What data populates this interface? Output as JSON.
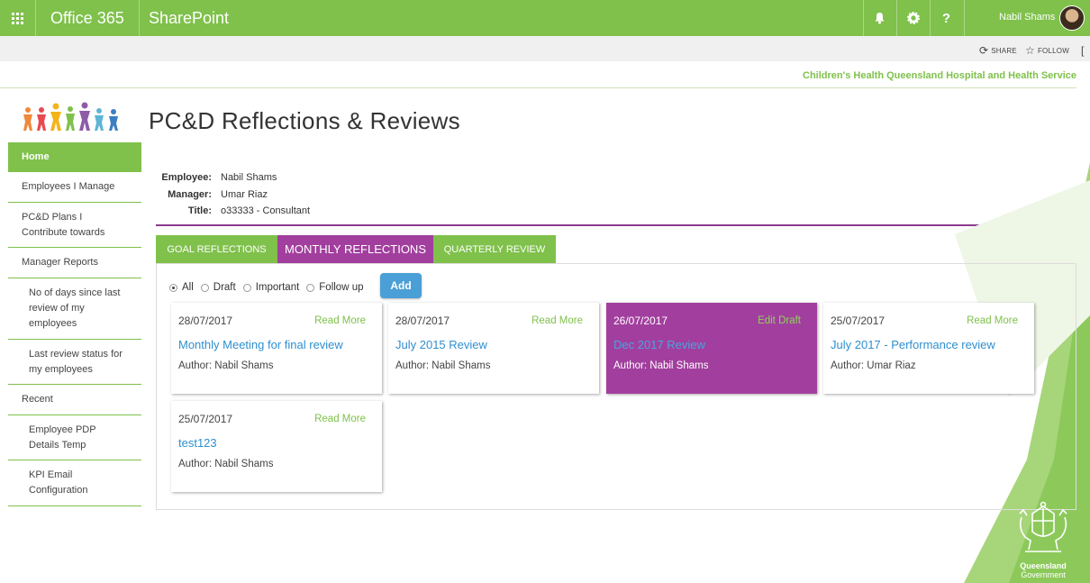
{
  "suitebar": {
    "brand": "Office 365",
    "app": "SharePoint",
    "help": "?",
    "user_name": "Nabil Shams"
  },
  "actions": {
    "share": "SHARE",
    "follow": "FOLLOW"
  },
  "org_name": "Children's Health Queensland Hospital and Health Service",
  "page_title": "PC&D Reflections & Reviews",
  "nav": [
    {
      "label": "Home",
      "active": true
    },
    {
      "label": "Employees I Manage"
    },
    {
      "label": "PC&D Plans I Contribute towards"
    },
    {
      "label": "Manager Reports"
    },
    {
      "label": "No of days since last review of my employees"
    },
    {
      "label": "Last review status for my employees"
    },
    {
      "label": "Recent"
    },
    {
      "label": "Employee PDP Details Temp"
    },
    {
      "label": "KPI Email Configuration"
    }
  ],
  "employee": {
    "employee_label": "Employee:",
    "employee": "Nabil Shams",
    "manager_label": "Manager:",
    "manager": "Umar Riaz",
    "title_label": "Title:",
    "title": "o33333 - Consultant"
  },
  "tabs": [
    "GOAL REFLECTIONS",
    "MONTHLY REFLECTIONS",
    "QUARTERLY REVIEW"
  ],
  "active_tab": "MONTHLY REFLECTIONS",
  "filters": {
    "options": [
      "All",
      "Draft",
      "Important",
      "Follow up"
    ],
    "selected": "All",
    "add_label": "Add"
  },
  "cards": [
    {
      "date": "28/07/2017",
      "link": "Read More",
      "title": "Monthly Meeting for final review",
      "author": "Author: Nabil Shams"
    },
    {
      "date": "28/07/2017",
      "link": "Read More",
      "title": "July 2015 Review",
      "author": "Author: Nabil Shams"
    },
    {
      "date": "26/07/2017",
      "link": "Edit Draft",
      "title": "Dec 2017 Review",
      "author": "Author: Nabil Shams",
      "draft": true
    },
    {
      "date": "25/07/2017",
      "link": "Read More",
      "title": "July 2017 - Performance review",
      "author": "Author: Umar Riaz"
    },
    {
      "date": "25/07/2017",
      "link": "Read More",
      "title": "test123",
      "author": "Author: Nabil Shams"
    }
  ],
  "footer_logo": {
    "line1": "Queensland",
    "line2": "Government"
  },
  "colors": {
    "brand_green": "#7fc14b",
    "accent_purple": "#a23f9e",
    "link_blue": "#2f8fd0"
  }
}
